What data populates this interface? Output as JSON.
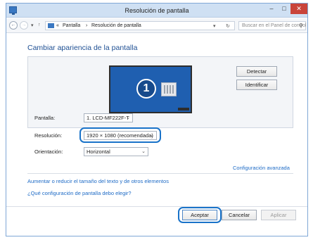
{
  "window": {
    "title": "Resolución de pantalla",
    "controls": {
      "minimize": "–",
      "maximize": "□",
      "close": "✕"
    }
  },
  "address": {
    "back": "←",
    "forward": "→",
    "recent": "▾",
    "up": "↑",
    "separator0": "«",
    "crumb1": "Pantalla",
    "separator1": "›",
    "crumb2": "Resolución de pantalla",
    "dropdown": "▾",
    "refresh": "↻",
    "search_placeholder": "Buscar en el Panel de control",
    "search_glyph": "⚲"
  },
  "main": {
    "heading": "Cambiar apariencia de la pantalla",
    "monitor_number": "1",
    "buttons": {
      "detect": "Detectar",
      "identify": "Identificar"
    },
    "screen": {
      "label": "Pantalla:",
      "value": "1. LCD-MF222F-T"
    },
    "resolution": {
      "label": "Resolución:",
      "value": "1920 × 1080 (recomendada)"
    },
    "orientation": {
      "label": "Orientación:",
      "value": "Horizontal"
    },
    "chevron": "⌄",
    "advanced_link": "Configuración avanzada",
    "links": [
      "Aumentar o reducir el tamaño del texto y de otros elementos",
      "¿Qué configuración de pantalla debo elegir?"
    ]
  },
  "footer": {
    "accept": "Aceptar",
    "cancel": "Cancelar",
    "apply": "Aplicar"
  },
  "colors": {
    "accent": "#1a73c9",
    "link": "#1e6bc6",
    "monitor": "#1f5fb0",
    "close_button": "#c9443a"
  }
}
